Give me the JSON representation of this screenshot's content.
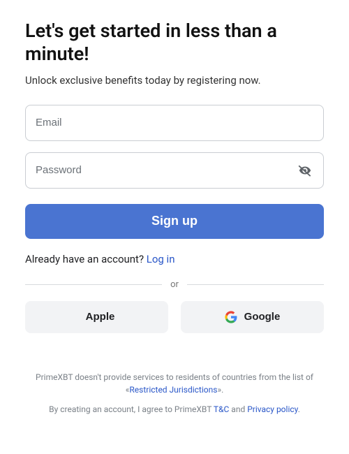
{
  "title": "Let's get started in less than a minute!",
  "subtitle": "Unlock exclusive benefits today by registering now.",
  "form": {
    "email_placeholder": "Email",
    "password_placeholder": "Password",
    "submit_label": "Sign up"
  },
  "alt": {
    "prompt": "Already have an account? ",
    "login_label": "Log in"
  },
  "divider": {
    "or": "or"
  },
  "social": {
    "apple_label": "Apple",
    "google_label": "Google"
  },
  "legal": {
    "note_pre": "PrimeXBT doesn't provide services to residents of countries from the list of «",
    "restricted_label": "Restricted Jurisdictions",
    "note_post": "».",
    "agree_pre": "By creating an account, I agree to PrimeXBT ",
    "tc_label": "T&C",
    "agree_mid": " and ",
    "privacy_label": "Privacy policy",
    "agree_post": "."
  }
}
